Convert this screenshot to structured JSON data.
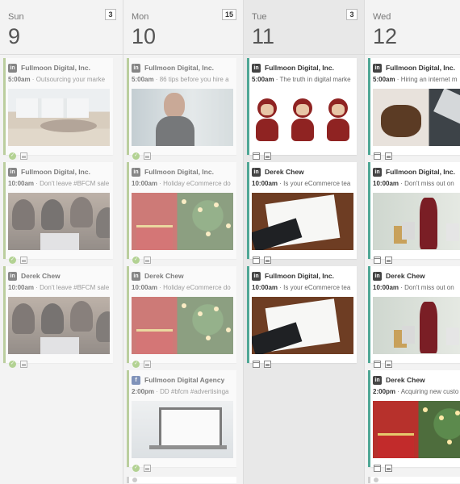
{
  "days": [
    {
      "name": "Sun",
      "number": "9",
      "count": "3"
    },
    {
      "name": "Mon",
      "number": "10",
      "count": "15"
    },
    {
      "name": "Tue",
      "number": "11",
      "count": "3"
    },
    {
      "name": "Wed",
      "number": "12",
      "count": ""
    }
  ],
  "networks": {
    "linkedin": "in",
    "facebook": "f"
  },
  "status_icons": {
    "published": "check-circle-icon",
    "scheduled": "calendar-icon",
    "media": "image-icon"
  },
  "colors": {
    "published": "#9ab86b",
    "scheduled": "#4fa795",
    "check": "#8cbf5a",
    "facebook": "#3b5998"
  },
  "posts": {
    "sun": [
      {
        "account": "Fullmoon Digital, Inc.",
        "time": "5:00am",
        "text": "Outsourcing your marke"
      },
      {
        "account": "Fullmoon Digital, Inc.",
        "time": "10:00am",
        "text": "Don't leave #BFCM sale"
      },
      {
        "account": "Derek Chew",
        "time": "10:00am",
        "text": "Don't leave #BFCM sale"
      }
    ],
    "mon": [
      {
        "account": "Fullmoon Digital, Inc.",
        "time": "5:00am",
        "text": "86 tips before you hire a"
      },
      {
        "account": "Fullmoon Digital, Inc.",
        "time": "10:00am",
        "text": "Holiday eCommerce do"
      },
      {
        "account": "Derek Chew",
        "time": "10:00am",
        "text": "Holiday eCommerce do"
      },
      {
        "account": "Fullmoon Digital Agency",
        "time": "2:00pm",
        "text": "DD #bfcm #advertisinga"
      }
    ],
    "tue": [
      {
        "account": "Fullmoon Digital, Inc.",
        "time": "5:00am",
        "text": "The truth in digital marke"
      },
      {
        "account": "Derek Chew",
        "time": "10:00am",
        "text": "Is your eCommerce tea"
      },
      {
        "account": "Fullmoon Digital, Inc.",
        "time": "10:00am",
        "text": "Is your eCommerce tea"
      }
    ],
    "wed": [
      {
        "account": "Fullmoon Digital, Inc.",
        "time": "5:00am",
        "text": "Hiring an internet m"
      },
      {
        "account": "Fullmoon Digital, Inc.",
        "time": "10:00am",
        "text": "Don't miss out on"
      },
      {
        "account": "Derek Chew",
        "time": "10:00am",
        "text": "Don't miss out on"
      },
      {
        "account": "Derek Chew",
        "time": "2:00pm",
        "text": "Acquiring new custo"
      }
    ]
  }
}
